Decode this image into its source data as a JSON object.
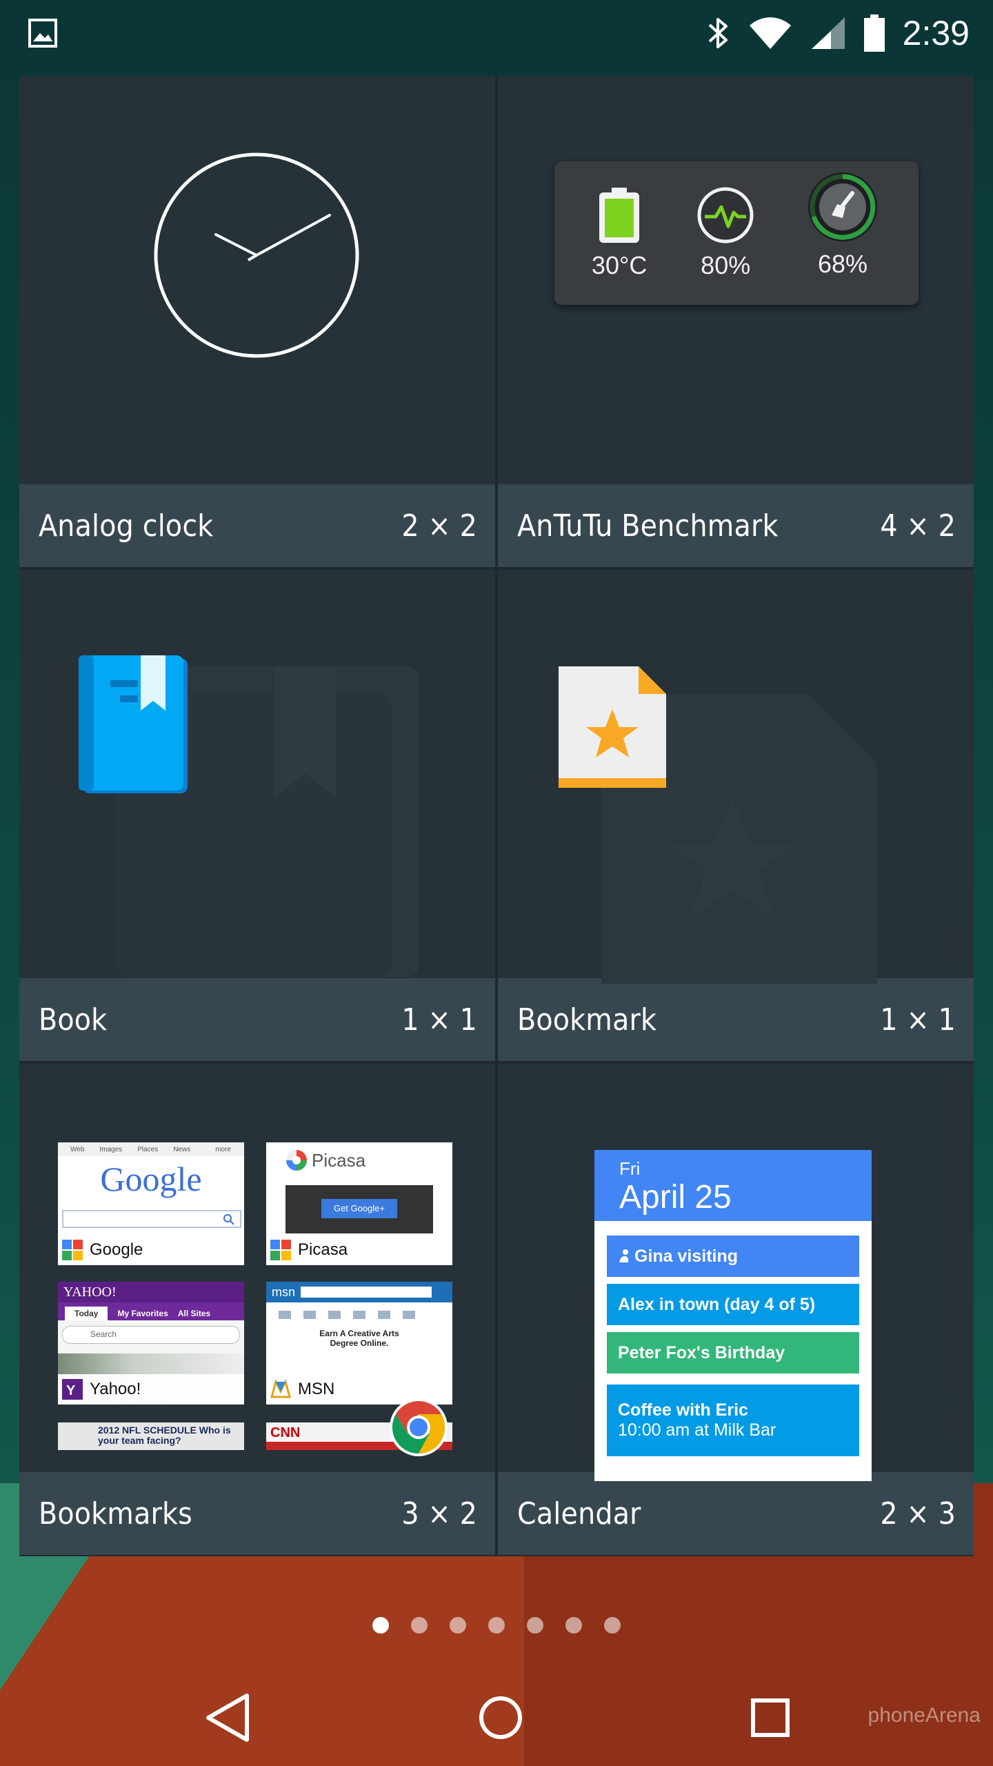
{
  "status_bar": {
    "time": "2:39",
    "icons": [
      "image-icon",
      "bluetooth-icon",
      "wifi-icon",
      "cell-signal-icon",
      "battery-icon"
    ]
  },
  "widgets": [
    {
      "name": "Analog clock",
      "size": "2 × 2"
    },
    {
      "name": "AnTuTu Benchmark",
      "size": "4 × 2"
    },
    {
      "name": "Book",
      "size": "1 × 1"
    },
    {
      "name": "Bookmark",
      "size": "1 × 1"
    },
    {
      "name": "Bookmarks",
      "size": "3 × 2"
    },
    {
      "name": "Calendar",
      "size": "2 × 3"
    }
  ],
  "antutu": {
    "temperature": "30°C",
    "performance": "80%",
    "clean": "68%"
  },
  "bookmarks": {
    "tiles": [
      {
        "label": "Google",
        "heading": "Google",
        "tabs": [
          "Web",
          "Images",
          "Places",
          "News",
          "more"
        ]
      },
      {
        "label": "Picasa",
        "heading": "Picasa",
        "button": "Get Google+"
      },
      {
        "label": "Yahoo!",
        "heading": "YAHOO!",
        "tabs": [
          "Today",
          "My Favorites",
          "All Sites"
        ],
        "search_placeholder": "Search"
      },
      {
        "label": "MSN",
        "heading": "msn",
        "text": "Earn A Creative Arts Degree Online."
      }
    ],
    "partial": [
      "2012 NFL SCHEDULE Who is your team facing?",
      "CNN"
    ]
  },
  "calendar": {
    "day": "Fri",
    "date": "April 25",
    "events": [
      {
        "title": "Gina visiting",
        "sub": "",
        "color": "#4285f4"
      },
      {
        "title": "Alex in town (day 4 of 5)",
        "sub": "",
        "color": "#039be5"
      },
      {
        "title": "Peter Fox's Birthday",
        "sub": "",
        "color": "#33b679"
      },
      {
        "title": "Coffee with Eric",
        "sub": "10:00 am at Milk Bar",
        "color": "#039be5"
      }
    ]
  },
  "pager": {
    "count": 7,
    "active": 0
  },
  "watermark": "phoneArena",
  "colors": {
    "label_bar": "#37474f",
    "preview_bg": "#263238",
    "antutu_green": "#7ed321",
    "calendar_header": "#4285f4"
  }
}
